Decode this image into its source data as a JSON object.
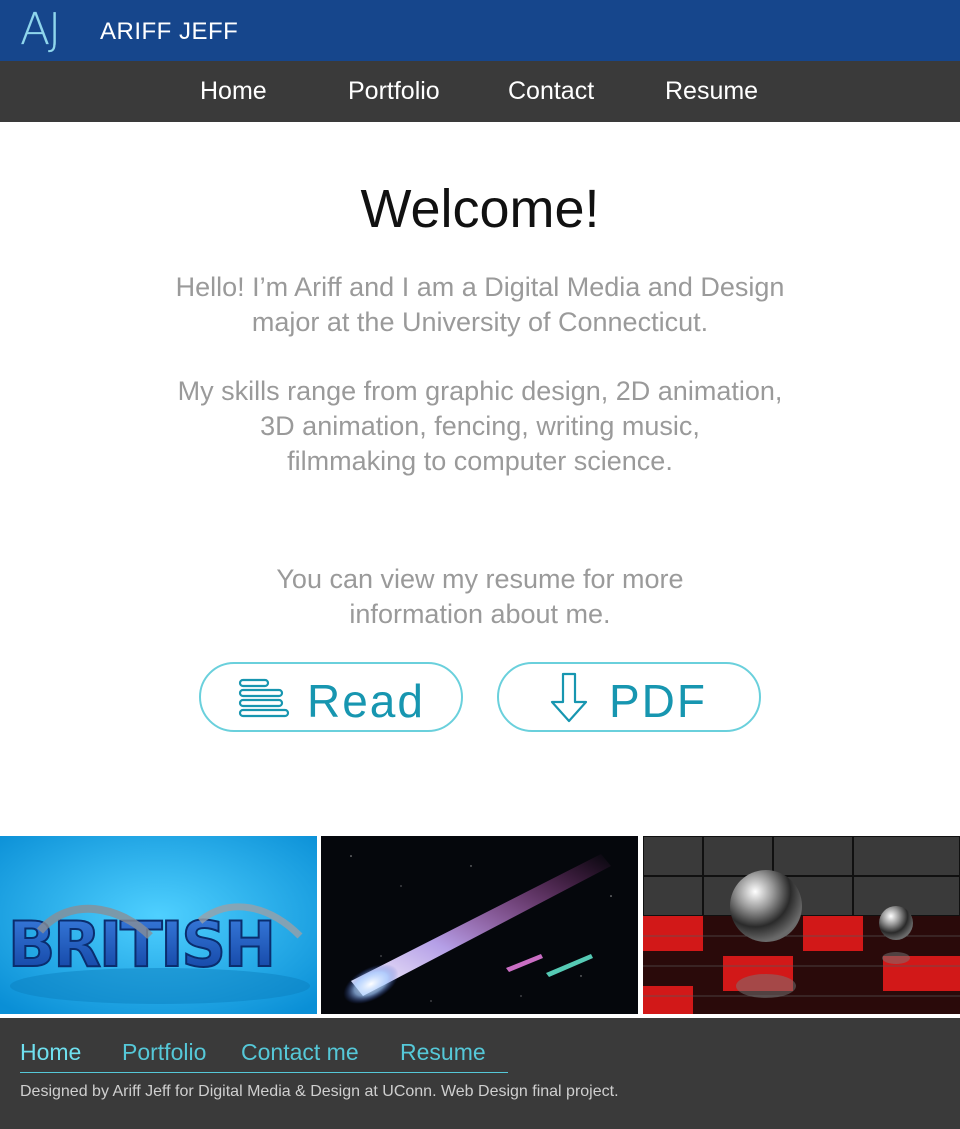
{
  "header": {
    "logo_mark": "AJ",
    "site_name": "ARIFF JEFF",
    "brand_color": "#16468c"
  },
  "nav": {
    "items": [
      {
        "label": "Home"
      },
      {
        "label": "Portfolio"
      },
      {
        "label": "Contact"
      },
      {
        "label": "Resume"
      }
    ]
  },
  "main": {
    "title": "Welcome!",
    "intro_lines": [
      "Hello! I’m Ariff and I am a Digital Media and Design",
      "major at the University of Connecticut."
    ],
    "skills_lines": [
      "My skills range from graphic design, 2D animation,",
      "3D animation, fencing, writing music,",
      "filmmaking to computer science."
    ],
    "resume_lines": [
      "You can view my resume for more",
      "information about me."
    ],
    "buttons": {
      "read": {
        "label": "Read",
        "icon": "text-lines-icon"
      },
      "pdf": {
        "label": "PDF",
        "icon": "download-arrow-icon"
      }
    },
    "accent_color": "#1796b0"
  },
  "gallery": {
    "images": [
      {
        "name": "british-3d-typography",
        "text": "BRITISH"
      },
      {
        "name": "comet-in-space"
      },
      {
        "name": "chrome-spheres-on-red-tiles"
      }
    ]
  },
  "footer": {
    "links": [
      {
        "label": "Home"
      },
      {
        "label": "Portfolio"
      },
      {
        "label": "Contact me"
      },
      {
        "label": "Resume"
      }
    ],
    "credits": "Designed by Ariff Jeff for Digital Media & Design at UConn. Web Design final project."
  }
}
